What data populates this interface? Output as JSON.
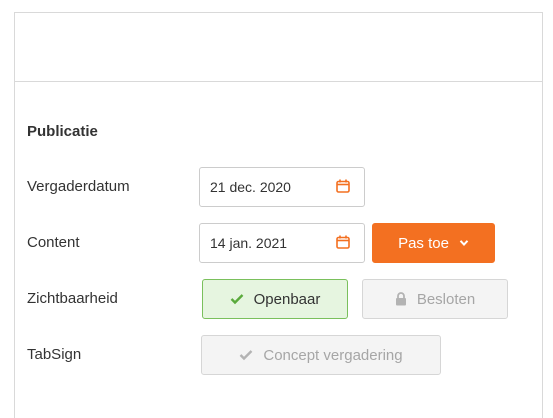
{
  "section": {
    "title": "Publicatie"
  },
  "rows": {
    "vergaderdatum": {
      "label": "Vergaderdatum",
      "value": "21 dec. 2020",
      "icon": "calendar-icon"
    },
    "content": {
      "label": "Content",
      "value": "14 jan. 2021",
      "icon": "calendar-icon",
      "apply_label": "Pas toe"
    },
    "zichtbaarheid": {
      "label": "Zichtbaarheid",
      "public_label": "Openbaar",
      "private_label": "Besloten",
      "selected": "Openbaar"
    },
    "tabsign": {
      "label": "TabSign",
      "concept_label": "Concept vergadering"
    }
  },
  "colors": {
    "accent": "#f37021",
    "success_bg": "#e6f5e0",
    "success_border": "#7ac05c",
    "disabled_bg": "#f4f4f4",
    "disabled_text": "#a6a6a6"
  }
}
